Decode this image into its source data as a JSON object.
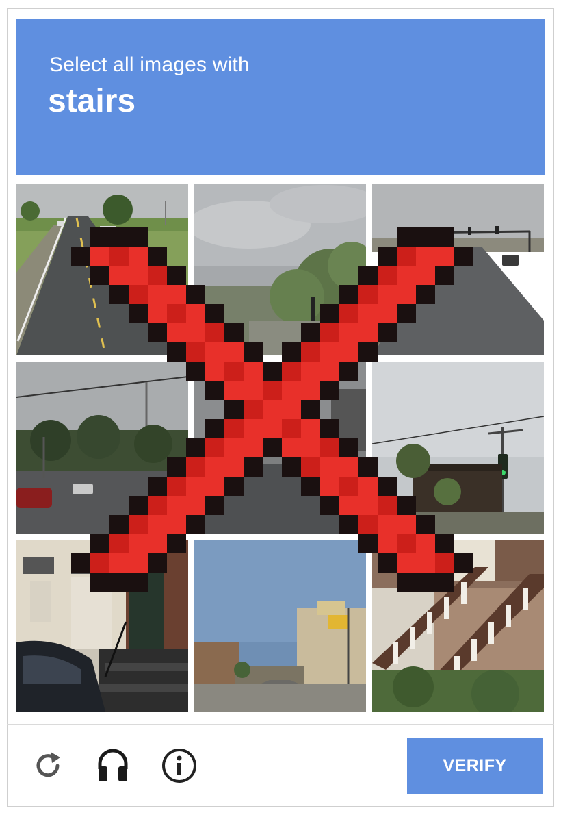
{
  "header": {
    "instruction": "Select all images with",
    "target": "stairs"
  },
  "tiles": [
    {
      "scene": "highway-with-pickup-truck"
    },
    {
      "scene": "cloudy-sky-with-tree"
    },
    {
      "scene": "highway-with-traffic-lights"
    },
    {
      "scene": "street-with-power-lines"
    },
    {
      "scene": "road-surface"
    },
    {
      "scene": "building-with-traffic-light"
    },
    {
      "scene": "doorway-with-steps-and-car"
    },
    {
      "scene": "town-main-street"
    },
    {
      "scene": "house-porch-stairs"
    }
  ],
  "footer": {
    "reload_icon": "reload-icon",
    "audio_icon": "headphones-icon",
    "info_icon": "info-icon",
    "verify_label": "VERIFY"
  },
  "overlay": {
    "symbol": "pixel-x-mark",
    "color": "#e8302a"
  },
  "colors": {
    "accent": "#5f8fe0"
  }
}
